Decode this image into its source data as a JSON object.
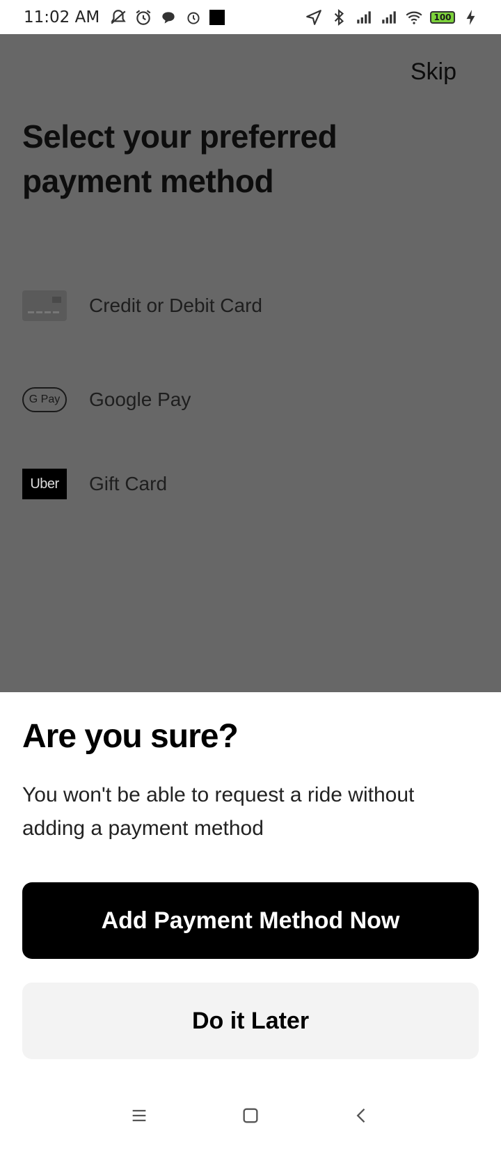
{
  "status_bar": {
    "time": "11:02 AM",
    "battery": "100",
    "icons_left": [
      "muted-bell-icon",
      "alarm-icon",
      "chat-bubble-icon",
      "alarm-outline-icon",
      "black-square-icon"
    ],
    "icons_right": [
      "location-arrow-icon",
      "bluetooth-icon",
      "signal-icon",
      "signal-icon",
      "wifi-icon",
      "battery-icon",
      "charging-icon"
    ]
  },
  "background": {
    "skip_label": "Skip",
    "title": "Select your preferred payment method",
    "options": [
      {
        "label": "Credit or Debit Card",
        "icon": "credit-card-icon"
      },
      {
        "label": "Google Pay",
        "icon": "google-pay-icon",
        "icon_text": "G Pay"
      },
      {
        "label": "Gift Card",
        "icon": "uber-gift-card-icon",
        "icon_text": "Uber"
      }
    ]
  },
  "sheet": {
    "title": "Are you sure?",
    "body": "You won't be able to request a ride without adding a payment method",
    "primary_button": "Add Payment Method Now",
    "secondary_button": "Do it Later"
  },
  "colors": {
    "overlay": "#676767",
    "primary_button_bg": "#000000",
    "secondary_button_bg": "#f3f3f3",
    "battery_fill": "#7cd23b"
  },
  "nav_bar": {
    "icons": [
      "menu-icon",
      "home-square-icon",
      "back-chevron-icon"
    ]
  }
}
